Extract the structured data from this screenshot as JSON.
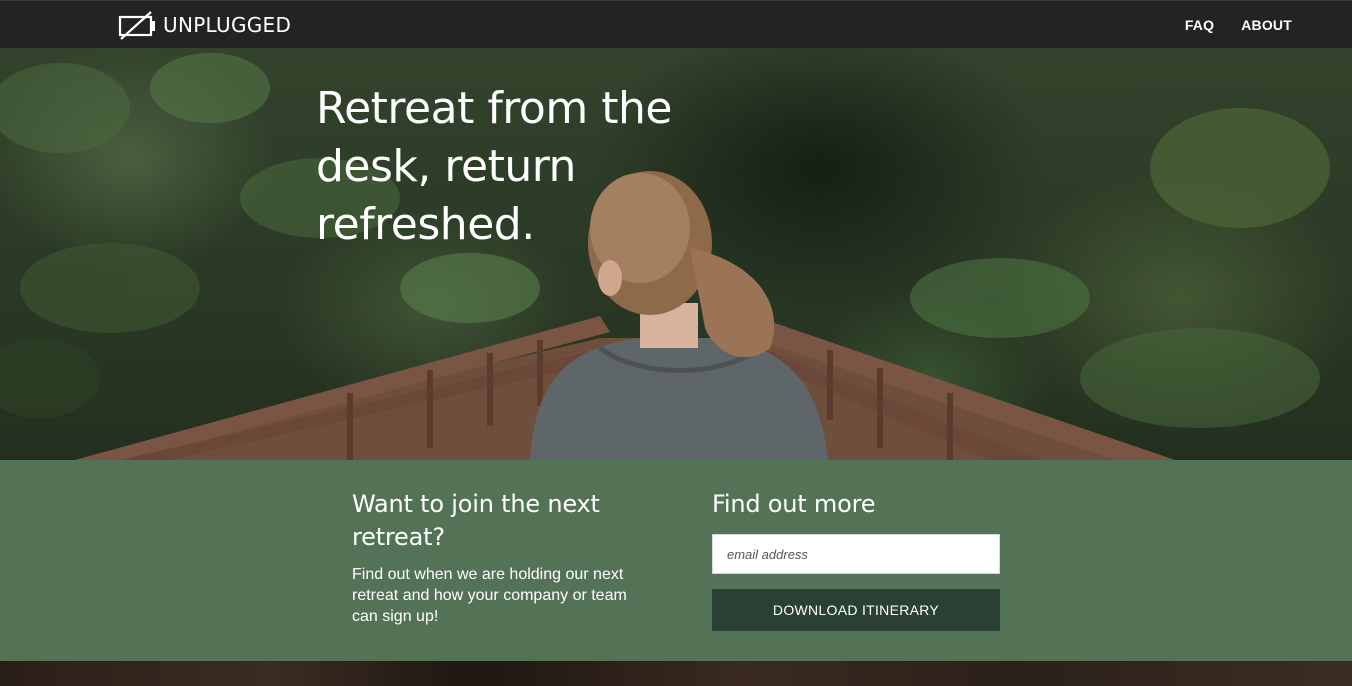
{
  "header": {
    "brand": "UNPLUGGED",
    "logo_icon": "camera-off-icon",
    "nav": [
      {
        "label": "FAQ"
      },
      {
        "label": "ABOUT"
      }
    ]
  },
  "hero": {
    "title": "Retreat from the desk, return refreshed."
  },
  "signup": {
    "join_heading": "Want to join the next retreat?",
    "join_text": "Find out when we are holding our next retreat and how your company or team can sign up!",
    "more_heading": "Find out more",
    "email_placeholder": "email address",
    "email_value": "",
    "button_label": "DOWNLOAD ITINERARY"
  },
  "colors": {
    "header_bg": "#222322",
    "band_bg": "#537256",
    "button_bg": "#2a4035",
    "text": "#ffffff"
  }
}
